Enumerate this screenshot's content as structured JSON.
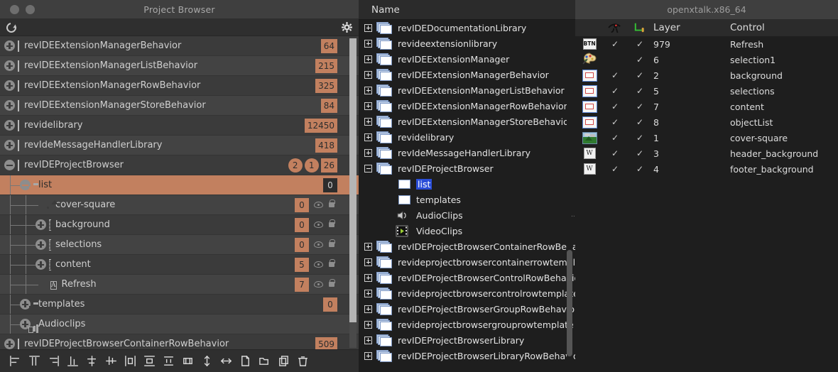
{
  "project_browser": {
    "title": "Project Browser",
    "toolbar_top": {
      "refresh_icon": "refresh-icon",
      "gear_icon": "gear-icon"
    },
    "rows": [
      {
        "label": "revIDEExtensionManagerBehavior",
        "indent": 0,
        "twisty": "plus",
        "icon": "card",
        "badges": [
          {
            "text": "64",
            "style": "square"
          }
        ],
        "eye": false,
        "striped": false
      },
      {
        "label": "revIDEExtensionManagerListBehavior",
        "indent": 0,
        "twisty": "plus",
        "icon": "card",
        "badges": [
          {
            "text": "215",
            "style": "square"
          }
        ],
        "eye": false,
        "striped": true
      },
      {
        "label": "revIDEExtensionManagerRowBehavior",
        "indent": 0,
        "twisty": "plus",
        "icon": "card",
        "badges": [
          {
            "text": "325",
            "style": "square"
          }
        ],
        "eye": false,
        "striped": false
      },
      {
        "label": "revIDEExtensionManagerStoreBehavior",
        "indent": 0,
        "twisty": "plus",
        "icon": "card",
        "badges": [
          {
            "text": "84",
            "style": "square"
          }
        ],
        "eye": false,
        "striped": true
      },
      {
        "label": "revidelibrary",
        "indent": 0,
        "twisty": "plus",
        "icon": "card",
        "badges": [
          {
            "text": "12450",
            "style": "square"
          }
        ],
        "eye": false,
        "striped": false
      },
      {
        "label": "revIdeMessageHandlerLibrary",
        "indent": 0,
        "twisty": "plus",
        "icon": "card",
        "badges": [
          {
            "text": "418",
            "style": "square"
          }
        ],
        "eye": false,
        "striped": true
      },
      {
        "label": "revIDEProjectBrowser",
        "indent": 0,
        "twisty": "minus",
        "icon": "card",
        "badges": [
          {
            "text": "2",
            "style": "oval"
          },
          {
            "text": "1",
            "style": "oval"
          },
          {
            "text": "26",
            "style": "square"
          }
        ],
        "eye": false,
        "striped": false
      },
      {
        "label": "list",
        "indent": 1,
        "twisty": "minus",
        "icon": "folder",
        "badges": [
          {
            "text": "0",
            "style": "dark"
          }
        ],
        "eye": false,
        "striped": false,
        "selected": true
      },
      {
        "label": "cover-square",
        "indent": 2,
        "twisty": "none",
        "icon": "image",
        "badges": [
          {
            "text": "0",
            "style": "square"
          }
        ],
        "eye": true,
        "striped": true
      },
      {
        "label": "background",
        "indent": 2,
        "twisty": "plus",
        "icon": "dots",
        "badges": [
          {
            "text": "0",
            "style": "square"
          }
        ],
        "eye": true,
        "striped": false
      },
      {
        "label": "selections",
        "indent": 2,
        "twisty": "plus",
        "icon": "dots",
        "badges": [
          {
            "text": "0",
            "style": "square"
          }
        ],
        "eye": true,
        "striped": true
      },
      {
        "label": "content",
        "indent": 2,
        "twisty": "plus",
        "icon": "dots",
        "badges": [
          {
            "text": "5",
            "style": "square"
          }
        ],
        "eye": true,
        "striped": false
      },
      {
        "label": "Refresh",
        "indent": 2,
        "twisty": "none",
        "icon": "btnA",
        "badges": [
          {
            "text": "7",
            "style": "square"
          }
        ],
        "eye": true,
        "striped": true
      },
      {
        "label": "templates",
        "indent": 1,
        "twisty": "plus",
        "icon": "folder",
        "badges": [
          {
            "text": "0",
            "style": "square"
          }
        ],
        "eye": false,
        "striped": false
      },
      {
        "label": "Audioclips",
        "indent": 1,
        "twisty": "plus",
        "icon": "audio",
        "badges": [],
        "eye": false,
        "striped": true
      },
      {
        "label": "revIDEProjectBrowserContainerRowBehavior",
        "indent": 0,
        "twisty": "plus",
        "icon": "card",
        "badges": [
          {
            "text": "509",
            "style": "square"
          }
        ],
        "eye": false,
        "striped": false
      }
    ],
    "bottom_toolbar": [
      "align-left-icon",
      "align-top-icon",
      "align-right-icon",
      "align-bottom-icon",
      "align-center-horizontal-icon",
      "align-center-vertical-icon",
      "distribute-horizontal-icon",
      "distribute-vertical-icon",
      "distribute-spacing-vertical-icon",
      "distribute-spacing-horizontal-icon",
      "resize-height-icon",
      "resize-width-icon",
      "new-file-icon",
      "open-folder-icon",
      "duplicate-icon",
      "delete-icon"
    ]
  },
  "stack_tree": {
    "header": "Name",
    "rows": [
      {
        "label": "revIDEDocumentationLibrary",
        "expander": "plus",
        "icon": "stack",
        "indent": 0
      },
      {
        "label": "revideextensionlibrary",
        "expander": "plus",
        "icon": "stack",
        "indent": 0
      },
      {
        "label": "revIDEExtensionManager",
        "expander": "plus",
        "icon": "stack",
        "indent": 0
      },
      {
        "label": "revIDEExtensionManagerBehavior",
        "expander": "plus",
        "icon": "stack",
        "indent": 0
      },
      {
        "label": "revIDEExtensionManagerListBehavior",
        "expander": "plus",
        "icon": "stack",
        "indent": 0
      },
      {
        "label": "revIDEExtensionManagerRowBehavior",
        "expander": "plus",
        "icon": "stack",
        "indent": 0
      },
      {
        "label": "revIDEExtensionManagerStoreBehavior",
        "expander": "plus",
        "icon": "stack",
        "indent": 0
      },
      {
        "label": "revidelibrary",
        "expander": "plus",
        "icon": "stack",
        "indent": 0
      },
      {
        "label": "revIdeMessageHandlerLibrary",
        "expander": "plus",
        "icon": "stack",
        "indent": 0
      },
      {
        "label": "revIDEProjectBrowser",
        "expander": "minus",
        "icon": "stack",
        "indent": 0
      },
      {
        "label": "list",
        "expander": "none",
        "icon": "card",
        "indent": 1,
        "highlighted": true
      },
      {
        "label": "templates",
        "expander": "none",
        "icon": "card",
        "indent": 1
      },
      {
        "label": "AudioClips",
        "expander": "none",
        "icon": "speaker",
        "indent": 1
      },
      {
        "label": "VideoClips",
        "expander": "none",
        "icon": "film",
        "indent": 1
      },
      {
        "label": "revIDEProjectBrowserContainerRowBehavior",
        "expander": "plus",
        "icon": "stack",
        "indent": 0
      },
      {
        "label": "revideprojectbrowsercontainerrowtemplate",
        "expander": "plus",
        "icon": "stack",
        "indent": 0
      },
      {
        "label": "revIDEProjectBrowserControlRowBehavior",
        "expander": "plus",
        "icon": "stack",
        "indent": 0
      },
      {
        "label": "revideprojectbrowsercontrolrowtemplate",
        "expander": "plus",
        "icon": "stack",
        "indent": 0
      },
      {
        "label": "revIDEProjectBrowserGroupRowBehavior",
        "expander": "plus",
        "icon": "stack",
        "indent": 0
      },
      {
        "label": "revideprojectbrowsergrouprowtemplate",
        "expander": "plus",
        "icon": "stack",
        "indent": 0
      },
      {
        "label": "revIDEProjectBrowserLibrary",
        "expander": "plus",
        "icon": "stack",
        "indent": 0
      },
      {
        "label": "revIDEProjectBrowserLibraryRowBehavior",
        "expander": "plus",
        "icon": "stack",
        "indent": 0
      }
    ]
  },
  "layer_panel": {
    "window_title": "openxtalk.x86_64",
    "columns": {
      "icon": "",
      "visible": "eye-of-horus-icon",
      "locked": "lock-icon",
      "layer": "Layer",
      "control": "Control"
    },
    "rows": [
      {
        "icon": "btn",
        "visible": true,
        "locked": true,
        "layer": "979",
        "control": "Refresh"
      },
      {
        "icon": "palette",
        "visible": false,
        "locked": true,
        "layer": "6",
        "control": "selection1"
      },
      {
        "icon": "group",
        "visible": true,
        "locked": true,
        "layer": "2",
        "control": "background"
      },
      {
        "icon": "group",
        "visible": true,
        "locked": true,
        "layer": "5",
        "control": "selections"
      },
      {
        "icon": "group",
        "visible": true,
        "locked": true,
        "layer": "7",
        "control": "content"
      },
      {
        "icon": "group",
        "visible": true,
        "locked": true,
        "layer": "8",
        "control": "objectList"
      },
      {
        "icon": "picture",
        "visible": true,
        "locked": true,
        "layer": "1",
        "control": "cover-square"
      },
      {
        "icon": "w",
        "visible": true,
        "locked": true,
        "layer": "3",
        "control": "header_background"
      },
      {
        "icon": "w",
        "visible": true,
        "locked": true,
        "layer": "4",
        "control": "footer_background"
      }
    ]
  },
  "colors": {
    "accent": "#c2805f",
    "selection_blue": "#2a4ed8",
    "panel_dark": "#1e1e1e",
    "panel_mid": "#3b3b3b"
  }
}
